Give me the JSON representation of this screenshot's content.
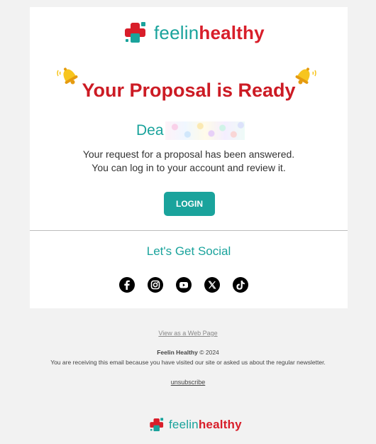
{
  "brand": {
    "name_prefix": "feelin",
    "name_suffix": "healthy",
    "primary_color": "#1aa39c",
    "accent_color": "#d81e2a"
  },
  "email": {
    "title": "Your Proposal is Ready",
    "greeting": "Dea",
    "message_line1": "Your request for a proposal has been answered.",
    "message_line2": "You can log in to your account and review it.",
    "login_label": "LOGIN",
    "social_heading": "Let's Get Social",
    "social_icons": [
      "facebook-icon",
      "instagram-icon",
      "youtube-icon",
      "x-icon",
      "tiktok-icon"
    ]
  },
  "footer": {
    "web_page_link": "View as a Web Page",
    "copyright_brand": "Feelin Healthy",
    "copyright_year": "© 2024",
    "notice": "You are receiving this email because you have visited our site or asked us about the regular newsletter.",
    "unsubscribe_label": "unsubscribe"
  }
}
